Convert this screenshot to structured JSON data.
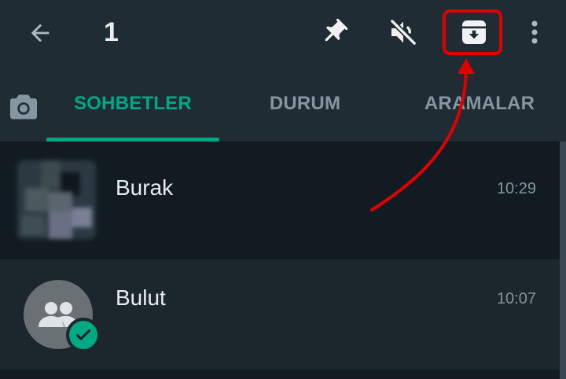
{
  "toolbar": {
    "back_icon": "arrow-left-icon",
    "selected_count": "1",
    "actions": [
      {
        "name": "pin-icon"
      },
      {
        "name": "mute-icon"
      },
      {
        "name": "archive-icon",
        "highlighted": true
      },
      {
        "name": "more-vert-icon"
      }
    ]
  },
  "tabs": {
    "camera_icon": "camera-icon",
    "items": [
      {
        "label": "SOHBETLER",
        "active": true
      },
      {
        "label": "DURUM",
        "active": false
      },
      {
        "label": "ARAMALAR",
        "active": false
      }
    ]
  },
  "chats": [
    {
      "name": "Burak",
      "time": "10:29",
      "avatar": "blurred-photo",
      "selected": false
    },
    {
      "name": "Bulut",
      "time": "10:07",
      "avatar": "group-icon",
      "selected": true,
      "badge": "check-icon"
    }
  ],
  "colors": {
    "accent": "#00a884",
    "highlight": "#e00000",
    "toolbar_bg": "#1f2c34",
    "list_bg": "#121b22",
    "selected_row_bg": "#1b262d"
  }
}
